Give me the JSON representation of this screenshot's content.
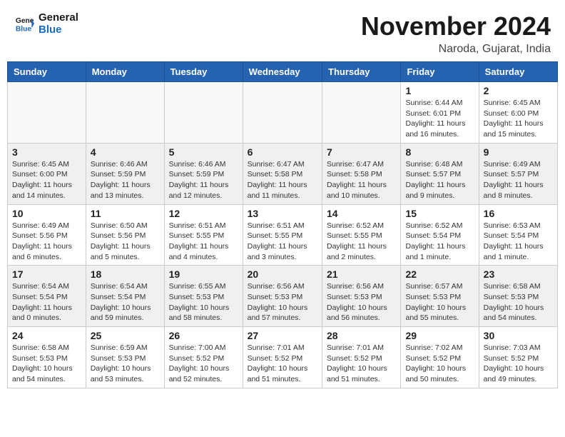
{
  "header": {
    "logo_line1": "General",
    "logo_line2": "Blue",
    "month": "November 2024",
    "location": "Naroda, Gujarat, India"
  },
  "days_of_week": [
    "Sunday",
    "Monday",
    "Tuesday",
    "Wednesday",
    "Thursday",
    "Friday",
    "Saturday"
  ],
  "weeks": [
    [
      {
        "day": "",
        "info": ""
      },
      {
        "day": "",
        "info": ""
      },
      {
        "day": "",
        "info": ""
      },
      {
        "day": "",
        "info": ""
      },
      {
        "day": "",
        "info": ""
      },
      {
        "day": "1",
        "info": "Sunrise: 6:44 AM\nSunset: 6:01 PM\nDaylight: 11 hours and 16 minutes."
      },
      {
        "day": "2",
        "info": "Sunrise: 6:45 AM\nSunset: 6:00 PM\nDaylight: 11 hours and 15 minutes."
      }
    ],
    [
      {
        "day": "3",
        "info": "Sunrise: 6:45 AM\nSunset: 6:00 PM\nDaylight: 11 hours and 14 minutes."
      },
      {
        "day": "4",
        "info": "Sunrise: 6:46 AM\nSunset: 5:59 PM\nDaylight: 11 hours and 13 minutes."
      },
      {
        "day": "5",
        "info": "Sunrise: 6:46 AM\nSunset: 5:59 PM\nDaylight: 11 hours and 12 minutes."
      },
      {
        "day": "6",
        "info": "Sunrise: 6:47 AM\nSunset: 5:58 PM\nDaylight: 11 hours and 11 minutes."
      },
      {
        "day": "7",
        "info": "Sunrise: 6:47 AM\nSunset: 5:58 PM\nDaylight: 11 hours and 10 minutes."
      },
      {
        "day": "8",
        "info": "Sunrise: 6:48 AM\nSunset: 5:57 PM\nDaylight: 11 hours and 9 minutes."
      },
      {
        "day": "9",
        "info": "Sunrise: 6:49 AM\nSunset: 5:57 PM\nDaylight: 11 hours and 8 minutes."
      }
    ],
    [
      {
        "day": "10",
        "info": "Sunrise: 6:49 AM\nSunset: 5:56 PM\nDaylight: 11 hours and 6 minutes."
      },
      {
        "day": "11",
        "info": "Sunrise: 6:50 AM\nSunset: 5:56 PM\nDaylight: 11 hours and 5 minutes."
      },
      {
        "day": "12",
        "info": "Sunrise: 6:51 AM\nSunset: 5:55 PM\nDaylight: 11 hours and 4 minutes."
      },
      {
        "day": "13",
        "info": "Sunrise: 6:51 AM\nSunset: 5:55 PM\nDaylight: 11 hours and 3 minutes."
      },
      {
        "day": "14",
        "info": "Sunrise: 6:52 AM\nSunset: 5:55 PM\nDaylight: 11 hours and 2 minutes."
      },
      {
        "day": "15",
        "info": "Sunrise: 6:52 AM\nSunset: 5:54 PM\nDaylight: 11 hours and 1 minute."
      },
      {
        "day": "16",
        "info": "Sunrise: 6:53 AM\nSunset: 5:54 PM\nDaylight: 11 hours and 1 minute."
      }
    ],
    [
      {
        "day": "17",
        "info": "Sunrise: 6:54 AM\nSunset: 5:54 PM\nDaylight: 11 hours and 0 minutes."
      },
      {
        "day": "18",
        "info": "Sunrise: 6:54 AM\nSunset: 5:54 PM\nDaylight: 10 hours and 59 minutes."
      },
      {
        "day": "19",
        "info": "Sunrise: 6:55 AM\nSunset: 5:53 PM\nDaylight: 10 hours and 58 minutes."
      },
      {
        "day": "20",
        "info": "Sunrise: 6:56 AM\nSunset: 5:53 PM\nDaylight: 10 hours and 57 minutes."
      },
      {
        "day": "21",
        "info": "Sunrise: 6:56 AM\nSunset: 5:53 PM\nDaylight: 10 hours and 56 minutes."
      },
      {
        "day": "22",
        "info": "Sunrise: 6:57 AM\nSunset: 5:53 PM\nDaylight: 10 hours and 55 minutes."
      },
      {
        "day": "23",
        "info": "Sunrise: 6:58 AM\nSunset: 5:53 PM\nDaylight: 10 hours and 54 minutes."
      }
    ],
    [
      {
        "day": "24",
        "info": "Sunrise: 6:58 AM\nSunset: 5:53 PM\nDaylight: 10 hours and 54 minutes."
      },
      {
        "day": "25",
        "info": "Sunrise: 6:59 AM\nSunset: 5:53 PM\nDaylight: 10 hours and 53 minutes."
      },
      {
        "day": "26",
        "info": "Sunrise: 7:00 AM\nSunset: 5:52 PM\nDaylight: 10 hours and 52 minutes."
      },
      {
        "day": "27",
        "info": "Sunrise: 7:01 AM\nSunset: 5:52 PM\nDaylight: 10 hours and 51 minutes."
      },
      {
        "day": "28",
        "info": "Sunrise: 7:01 AM\nSunset: 5:52 PM\nDaylight: 10 hours and 51 minutes."
      },
      {
        "day": "29",
        "info": "Sunrise: 7:02 AM\nSunset: 5:52 PM\nDaylight: 10 hours and 50 minutes."
      },
      {
        "day": "30",
        "info": "Sunrise: 7:03 AM\nSunset: 5:52 PM\nDaylight: 10 hours and 49 minutes."
      }
    ]
  ]
}
